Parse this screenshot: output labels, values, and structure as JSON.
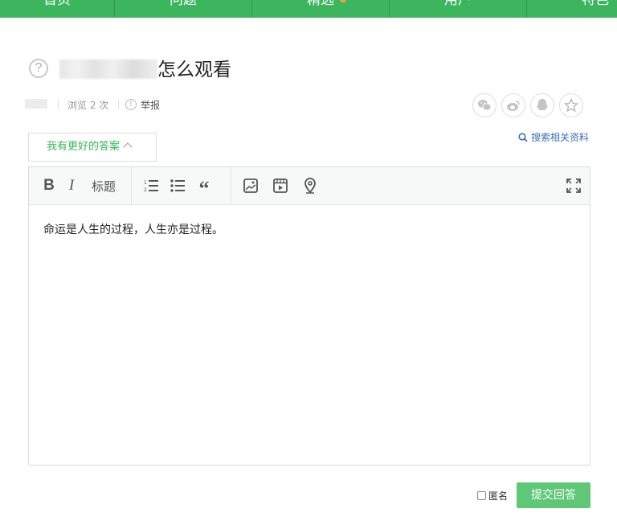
{
  "nav": {
    "items": [
      "首页",
      "问题",
      "精选",
      "用户",
      "特色"
    ]
  },
  "question": {
    "title_visible": "怎么观看"
  },
  "meta": {
    "views": "浏览 2 次",
    "report": "举报"
  },
  "share": {
    "icons": [
      "wechat-icon",
      "weibo-icon",
      "qq-icon",
      "favorite-icon"
    ]
  },
  "answer_toggle": "我有更好的答案",
  "search_link": "搜索相关资料",
  "toolbar": {
    "bold": "B",
    "italic": "I",
    "heading": "标题",
    "quote": "“"
  },
  "editor": {
    "content": "命运是人生的过程，人生亦是过程。"
  },
  "footer": {
    "anonymous": "匿名",
    "submit": "提交回答"
  },
  "colors": {
    "brand": "#3cb55e",
    "submit": "#5fc777",
    "link": "#3f6fb3"
  }
}
